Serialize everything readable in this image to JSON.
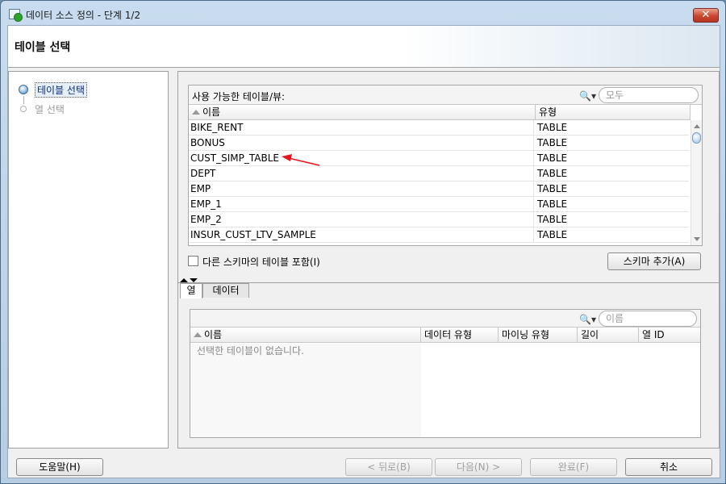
{
  "window": {
    "title": "데이터 소스 정의 - 단계 1/2",
    "close_glyph": "✕"
  },
  "header": {
    "title": "테이블 선택"
  },
  "nav": {
    "items": [
      {
        "label": "테이블 선택",
        "state": "active"
      },
      {
        "label": "열 선택",
        "state": "inactive"
      }
    ]
  },
  "available": {
    "label": "사용 가능한 테이블/뷰:",
    "search_placeholder": "모두",
    "columns": [
      "이름",
      "유형"
    ],
    "rows": [
      {
        "name": "BIKE_RENT",
        "type": "TABLE"
      },
      {
        "name": "BONUS",
        "type": "TABLE"
      },
      {
        "name": "CUST_SIMP_TABLE",
        "type": "TABLE"
      },
      {
        "name": "DEPT",
        "type": "TABLE"
      },
      {
        "name": "EMP",
        "type": "TABLE"
      },
      {
        "name": "EMP_1",
        "type": "TABLE"
      },
      {
        "name": "EMP_2",
        "type": "TABLE"
      },
      {
        "name": "INSUR_CUST_LTV_SAMPLE",
        "type": "TABLE"
      }
    ],
    "annotation_color": "#e8141e"
  },
  "include_other_schema": {
    "label": "다른 스키마의 테이블 포함(I)",
    "checked": false
  },
  "add_schema_button": "스키마 추가(A)",
  "lower": {
    "tabs": [
      "열",
      "데이터"
    ],
    "search_placeholder": "이름",
    "columns": [
      "이름",
      "데이터 유형",
      "마이닝 유형",
      "길이",
      "열 ID"
    ],
    "empty_message": "선택한 테이블이 없습니다."
  },
  "footer": {
    "help": "도움말(H)",
    "back": "< 뒤로(B)",
    "next": "다음(N) >",
    "finish": "완료(F)",
    "cancel": "취소"
  }
}
